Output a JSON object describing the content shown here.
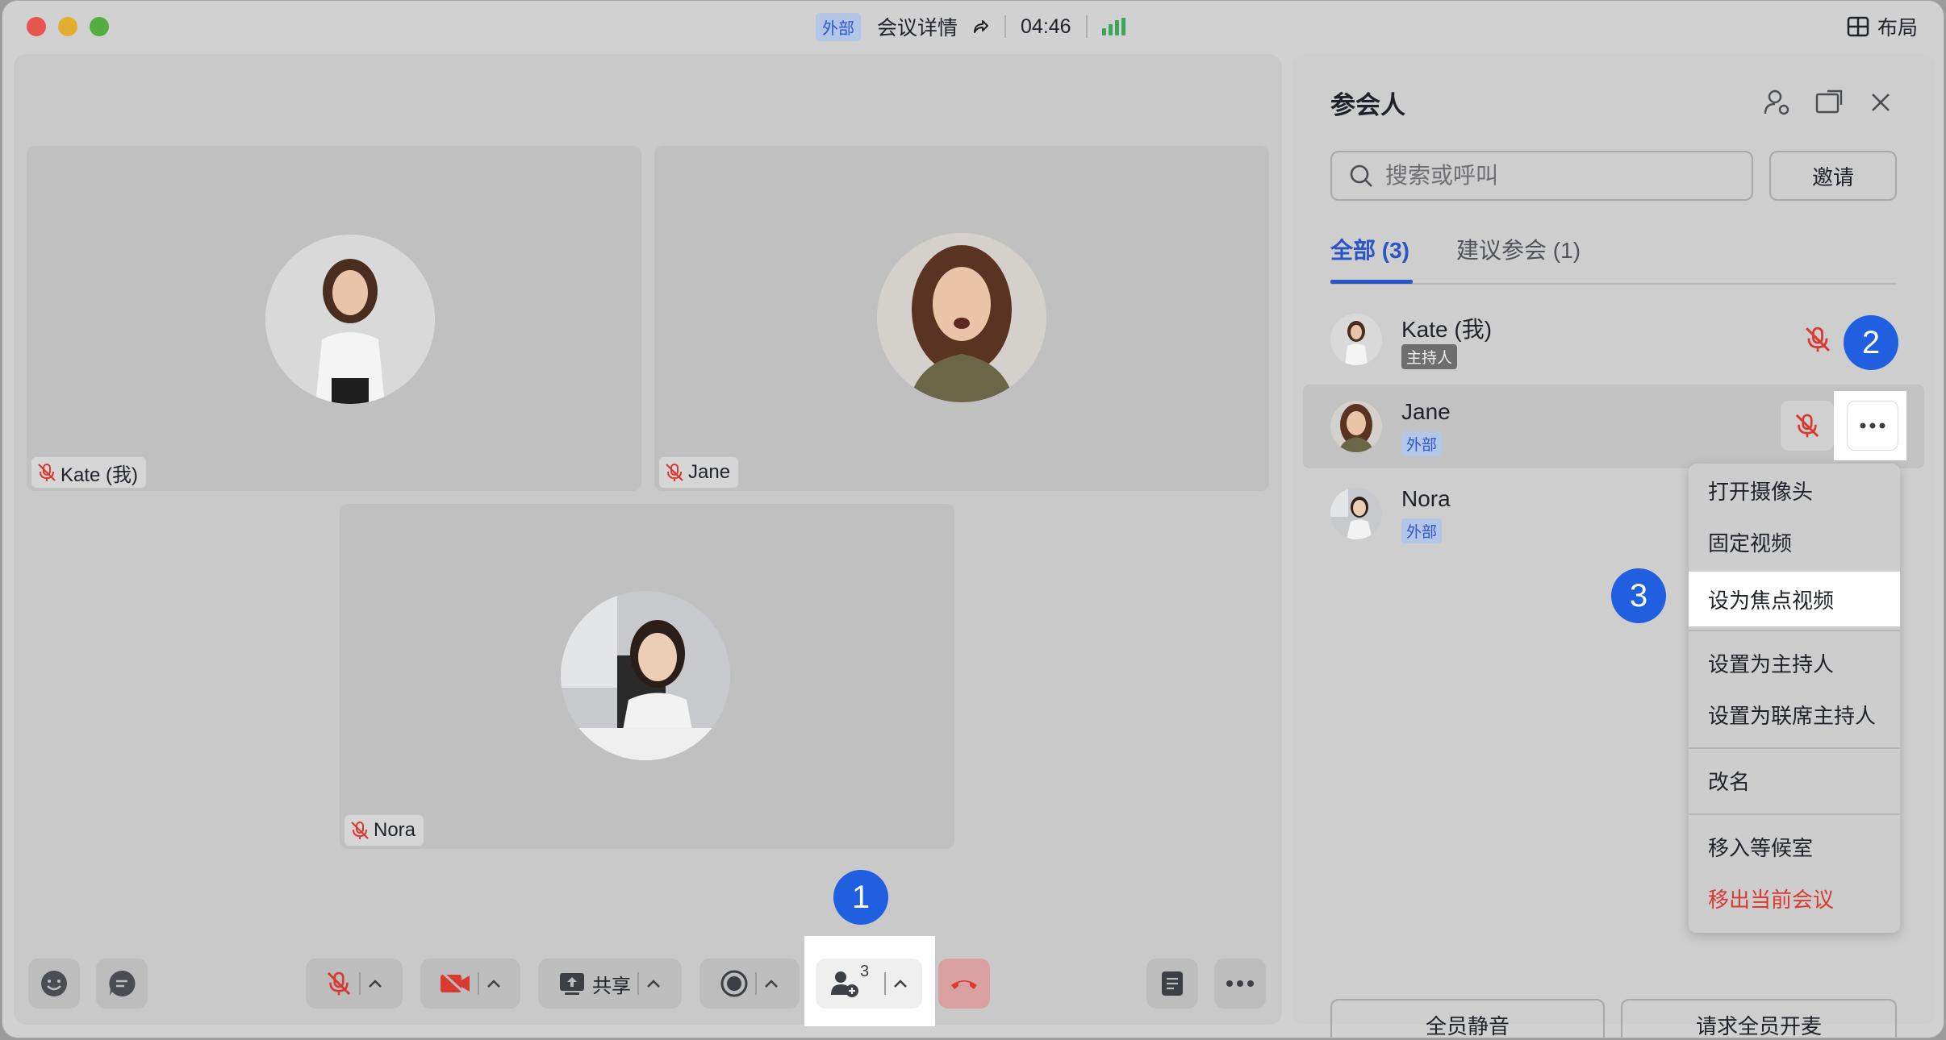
{
  "titlebar": {
    "external_tag": "外部",
    "meeting_details": "会议详情",
    "timer": "04:46",
    "layout_label": "布局"
  },
  "stage": {
    "tiles": [
      {
        "name": "Kate (我)"
      },
      {
        "name": "Jane"
      },
      {
        "name": "Nora"
      }
    ]
  },
  "toolbar": {
    "share_label": "共享",
    "participants_count": "3"
  },
  "steps": [
    "1",
    "2",
    "3"
  ],
  "panel": {
    "title": "参会人",
    "search_placeholder": "搜索或呼叫",
    "invite_label": "邀请",
    "tabs": [
      {
        "label": "全部 (3)"
      },
      {
        "label": "建议参会 (1)"
      }
    ],
    "participants": [
      {
        "name": "Kate (我)",
        "tag": "主持人"
      },
      {
        "name": "Jane",
        "tag": "外部"
      },
      {
        "name": "Nora",
        "tag": "外部"
      }
    ],
    "menu": [
      {
        "label": "打开摄像头"
      },
      {
        "label": "固定视频"
      },
      {
        "label": "设为焦点视频"
      },
      {
        "label": "设置为主持人"
      },
      {
        "label": "设置为联席主持人"
      },
      {
        "label": "改名"
      },
      {
        "label": "移入等候室"
      },
      {
        "label": "移出当前会议"
      }
    ],
    "mute_all_label": "全员静音",
    "request_unmute_label": "请求全员开麦"
  },
  "colors": {
    "accent": "#2a55c7",
    "danger": "#d83931",
    "step_badge": "#1f5fe0"
  }
}
